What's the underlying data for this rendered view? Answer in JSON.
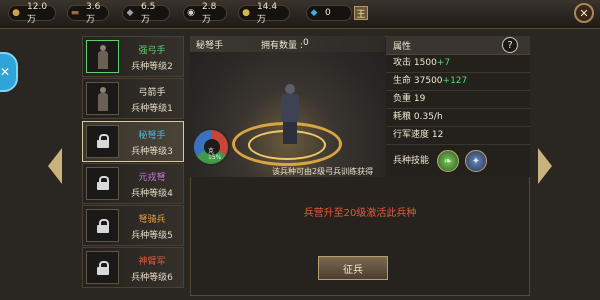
{
  "resources": [
    {
      "icon": "food-icon",
      "glyph": "●",
      "color": "#c8a44a",
      "value": "12.0万"
    },
    {
      "icon": "wood-icon",
      "glyph": "▬",
      "color": "#9a6a3a",
      "value": "3.6万"
    },
    {
      "icon": "iron-icon",
      "glyph": "◆",
      "color": "#9aa0a8",
      "value": "6.5万"
    },
    {
      "icon": "silver-icon",
      "glyph": "◉",
      "color": "#d0d0d0",
      "value": "2.8万"
    },
    {
      "icon": "coin-icon",
      "glyph": "●",
      "color": "#d8b84a",
      "value": "14.4万"
    },
    {
      "icon": "gem-icon",
      "glyph": "◆",
      "color": "#3ab0e8",
      "value": "0"
    }
  ],
  "topbar": {
    "plus_label": "王",
    "close_label": "✕"
  },
  "units": [
    {
      "name": "强弓手",
      "name_color": "#5fd36b",
      "level": "兵种等级2",
      "locked": false
    },
    {
      "name": "弓箭手",
      "name_color": "#efe7d2",
      "level": "兵种等级1",
      "locked": false
    },
    {
      "name": "秘弩手",
      "name_color": "#4fb8e8",
      "level": "兵种等级3",
      "locked": true
    },
    {
      "name": "元戎弩",
      "name_color": "#c47ad8",
      "level": "兵种等级4",
      "locked": true
    },
    {
      "name": "弩骑兵",
      "name_color": "#e8a040",
      "level": "兵种等级5",
      "locked": true
    },
    {
      "name": "神臂军",
      "name_color": "#e05a3a",
      "level": "兵种等级6",
      "locked": true
    }
  ],
  "scene": {
    "unit_name": "秘弩手",
    "owned_label": "拥有数量 :",
    "owned_value": "0",
    "caption": "该兵种可由2级弓兵训练获得",
    "wheel_l1": "克",
    "wheel_l2": "15%"
  },
  "attributes": {
    "title": "属性",
    "help_label": "?",
    "rows": [
      {
        "label": "攻击",
        "value": "1500",
        "bonus": "+7"
      },
      {
        "label": "生命",
        "value": "37500",
        "bonus": "+127"
      },
      {
        "label": "负重",
        "value": "19",
        "bonus": ""
      },
      {
        "label": "耗粮",
        "value": "0.35/h",
        "bonus": ""
      },
      {
        "label": "行军速度",
        "value": "12",
        "bonus": ""
      }
    ],
    "skills_label": "兵种技能"
  },
  "unlock_message": "兵营升至20级激活此兵种",
  "recruit_label": "征兵"
}
